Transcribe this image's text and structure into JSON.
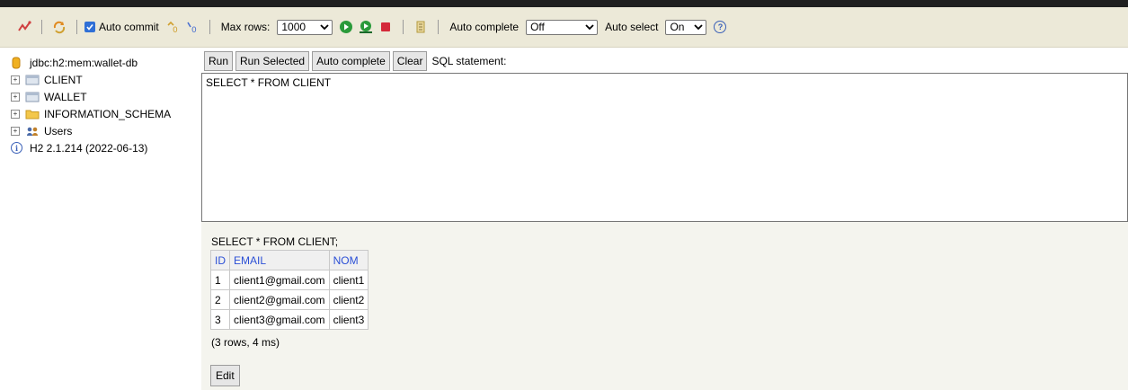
{
  "toolbar": {
    "auto_commit_label": "Auto commit",
    "auto_commit_checked": true,
    "max_rows_label": "Max rows:",
    "max_rows_value": "1000",
    "auto_complete_label": "Auto complete",
    "auto_complete_value": "Off",
    "auto_select_label": "Auto select",
    "auto_select_value": "On",
    "help_glyph": "?"
  },
  "tree": {
    "connection": "jdbc:h2:mem:wallet-db",
    "items": [
      {
        "label": "CLIENT",
        "icon": "table-icon"
      },
      {
        "label": "WALLET",
        "icon": "table-icon"
      },
      {
        "label": "INFORMATION_SCHEMA",
        "icon": "folder-icon"
      },
      {
        "label": "Users",
        "icon": "users-icon"
      }
    ],
    "version": "H2 2.1.214 (2022-06-13)",
    "expand_glyph": "+",
    "info_glyph": "i"
  },
  "sql_buttons": {
    "run": "Run",
    "run_selected": "Run Selected",
    "auto_complete": "Auto complete",
    "clear": "Clear",
    "sql_label": "SQL statement:"
  },
  "sql_text": "SELECT * FROM CLIENT",
  "result": {
    "statement": "SELECT * FROM CLIENT;",
    "columns": [
      "ID",
      "EMAIL",
      "NOM"
    ],
    "rows": [
      [
        "1",
        "client1@gmail.com",
        "client1"
      ],
      [
        "2",
        "client2@gmail.com",
        "client2"
      ],
      [
        "3",
        "client3@gmail.com",
        "client3"
      ]
    ],
    "info": "(3 rows, 4 ms)",
    "edit_label": "Edit"
  }
}
